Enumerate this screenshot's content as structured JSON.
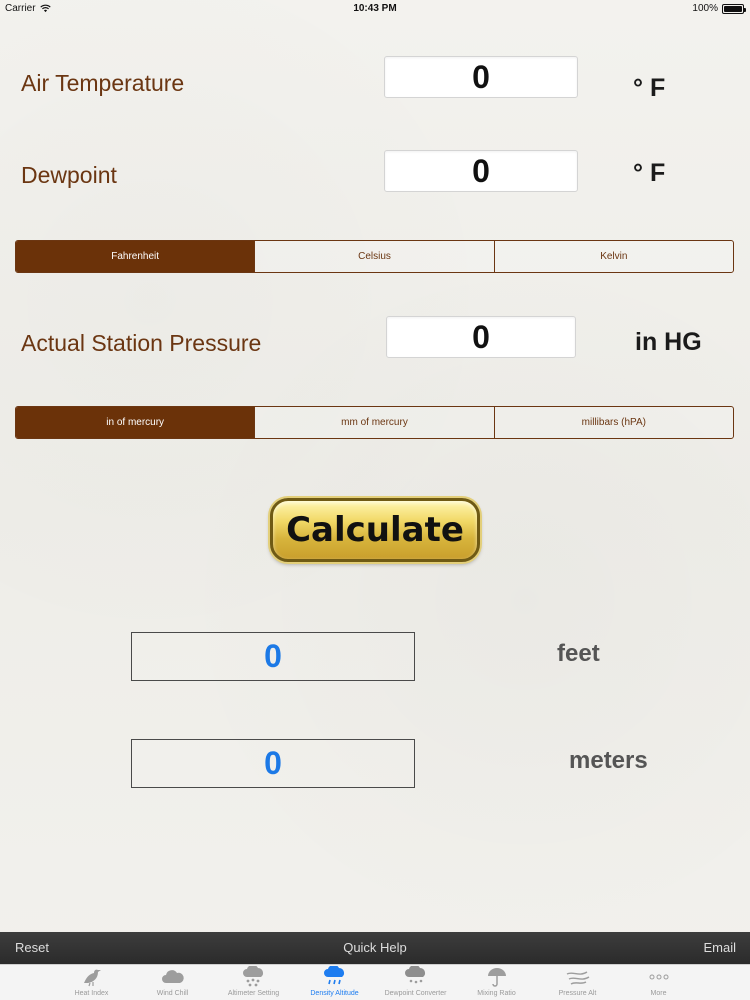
{
  "status_bar": {
    "carrier": "Carrier",
    "time": "10:43 PM",
    "battery": "100%"
  },
  "air_temperature": {
    "label": "Air Temperature",
    "value": "0",
    "unit": "° F"
  },
  "dewpoint": {
    "label": "Dewpoint",
    "value": "0",
    "unit": "° F"
  },
  "temperature_scale": {
    "options": [
      "Fahrenheit",
      "Celsius",
      "Kelvin"
    ],
    "selected": "Fahrenheit"
  },
  "station_pressure": {
    "label": "Actual Station Pressure",
    "value": "0",
    "unit": "in HG"
  },
  "pressure_units": {
    "options": [
      "in of mercury",
      "mm of mercury",
      "millibars (hPA)"
    ],
    "selected": "in of mercury"
  },
  "calculate_label": "Calculate",
  "results": {
    "feet": {
      "value": "0",
      "unit": "feet"
    },
    "meters": {
      "value": "0",
      "unit": "meters"
    }
  },
  "toolbar": {
    "reset": "Reset",
    "help": "Quick Help",
    "email": "Email"
  },
  "tabs": [
    {
      "label": "Heat Index",
      "icon": "bird-icon"
    },
    {
      "label": "Wind Chill",
      "icon": "cloud-icon"
    },
    {
      "label": "Altimeter Setting",
      "icon": "snow-cloud-icon"
    },
    {
      "label": "Density Altitude",
      "icon": "rain-cloud-icon",
      "active": true
    },
    {
      "label": "Dewpoint Converter",
      "icon": "storm-cloud-icon"
    },
    {
      "label": "Mixing Ratio",
      "icon": "umbrella-icon"
    },
    {
      "label": "Pressure Alt",
      "icon": "wind-icon"
    },
    {
      "label": "More",
      "icon": "more-dots-icon"
    }
  ],
  "colors": {
    "accent_brown": "#6b3209",
    "result_blue": "#1c79e6",
    "active_tab_blue": "#1e7df0"
  }
}
